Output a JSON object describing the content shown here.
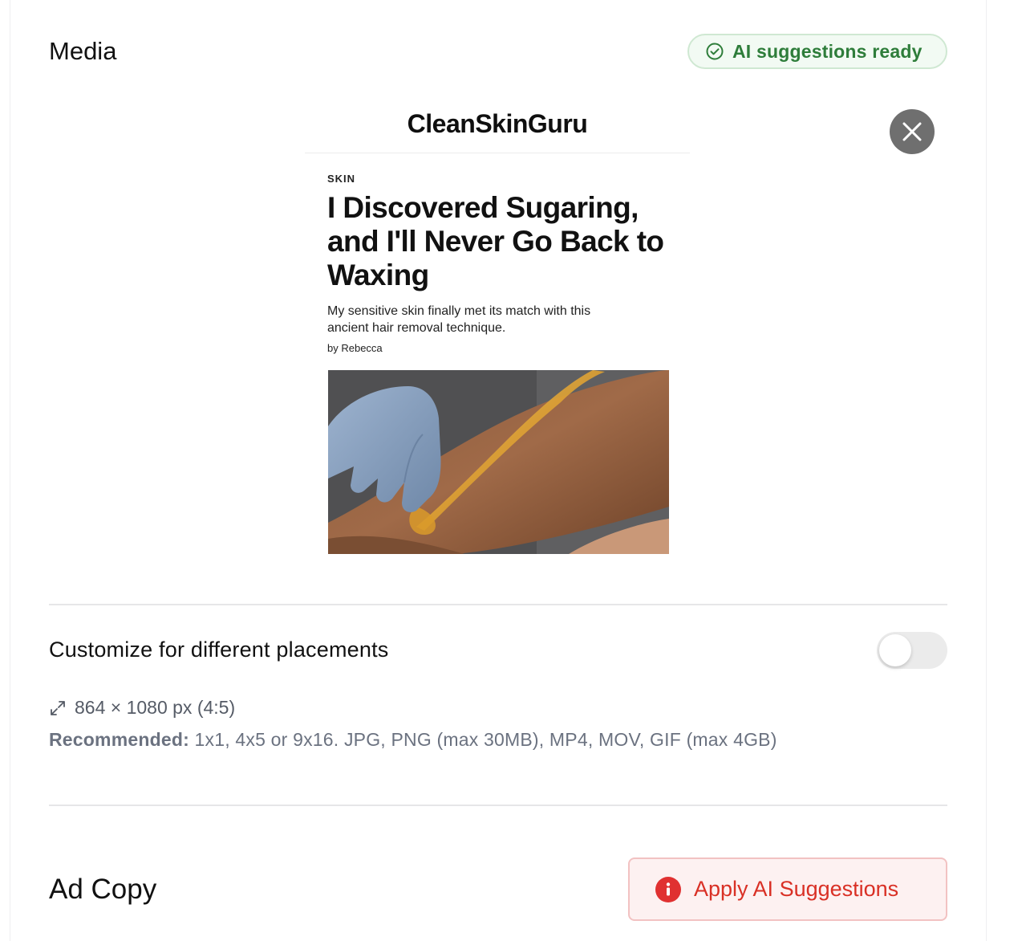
{
  "media": {
    "title": "Media",
    "ai_badge": "AI suggestions ready"
  },
  "creative": {
    "brand": "CleanSkinGuru",
    "kicker": "SKIN",
    "headline": "I Discovered Sugaring, and I'll Never Go Back to Waxing",
    "dek": "My sensitive skin finally met its match with this ancient hair removal technique.",
    "byline": "by Rebecca",
    "image_alt": "Gloved hand applying sugaring paste to an arm"
  },
  "placements": {
    "label": "Customize for different placements",
    "toggle_on": false
  },
  "specs": {
    "dimensions": "864 × 1080 px (4:5)",
    "recommended_label": "Recommended:",
    "recommended_text": " 1x1, 4x5 or 9x16. JPG, PNG (max 30MB), MP4, MOV, GIF (max 4GB)"
  },
  "ad_copy": {
    "title": "Ad Copy",
    "apply_button": "Apply AI Suggestions"
  },
  "colors": {
    "success": "#2e7d3a",
    "danger": "#d93025",
    "muted": "#6b7280"
  }
}
